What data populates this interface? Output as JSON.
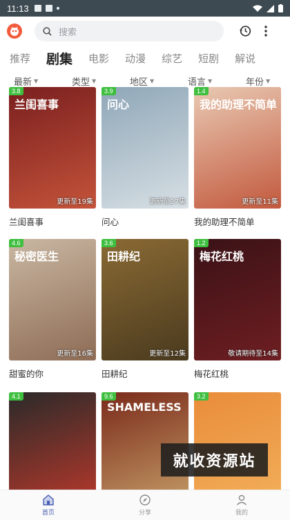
{
  "status_bar": {
    "time": "11:13"
  },
  "search": {
    "placeholder": "搜索"
  },
  "tabs": [
    {
      "label": "推荐",
      "active": false
    },
    {
      "label": "剧集",
      "active": true
    },
    {
      "label": "电影",
      "active": false
    },
    {
      "label": "动漫",
      "active": false
    },
    {
      "label": "综艺",
      "active": false
    },
    {
      "label": "短剧",
      "active": false
    },
    {
      "label": "解说",
      "active": false
    }
  ],
  "filters": [
    {
      "label": "最新"
    },
    {
      "label": "类型"
    },
    {
      "label": "地区"
    },
    {
      "label": "语言"
    },
    {
      "label": "年份"
    }
  ],
  "cards": [
    {
      "title": "兰闺喜事",
      "score": "3.8",
      "update": "更新至19集",
      "poster_text": "兰闺喜事",
      "colors": [
        "#7a1f1f",
        "#c4533a"
      ]
    },
    {
      "title": "问心",
      "score": "3.9",
      "update": "更新至27集",
      "poster_text": "问心",
      "colors": [
        "#8fa7b8",
        "#d7dfe4"
      ]
    },
    {
      "title": "我的助理不简单",
      "score": "1.4",
      "update": "更新至11集",
      "poster_text": "我的助理不简单",
      "colors": [
        "#e9c9b3",
        "#c2593d"
      ]
    },
    {
      "title": "甜蜜的你",
      "score": "4.6",
      "update": "更新至16集",
      "poster_text": "秘密医生",
      "colors": [
        "#c9b7a2",
        "#8e6c55"
      ]
    },
    {
      "title": "田耕纪",
      "score": "3.6",
      "update": "更新至12集",
      "poster_text": "田耕纪",
      "colors": [
        "#8a6a34",
        "#4a3a1e"
      ]
    },
    {
      "title": "梅花红桃",
      "score": "1.2",
      "update": "敬请期待至14集",
      "poster_text": "梅花红桃",
      "colors": [
        "#3a1216",
        "#6e1e22"
      ]
    },
    {
      "title": "",
      "score": "4.1",
      "update": "",
      "poster_text": "",
      "colors": [
        "#2a2a2a",
        "#c0392b"
      ]
    },
    {
      "title": "",
      "score": "9.6",
      "update": "",
      "poster_text": "SHAMELESS",
      "colors": [
        "#7a2a1a",
        "#c8a26b"
      ]
    },
    {
      "title": "",
      "score": "3.2",
      "update": "",
      "poster_text": "",
      "colors": [
        "#e98c3a",
        "#f3b15c"
      ]
    }
  ],
  "bottom_nav": [
    {
      "label": "首页",
      "active": true
    },
    {
      "label": "分享",
      "active": false
    },
    {
      "label": "我的",
      "active": false
    }
  ],
  "watermark": "就收资源站"
}
